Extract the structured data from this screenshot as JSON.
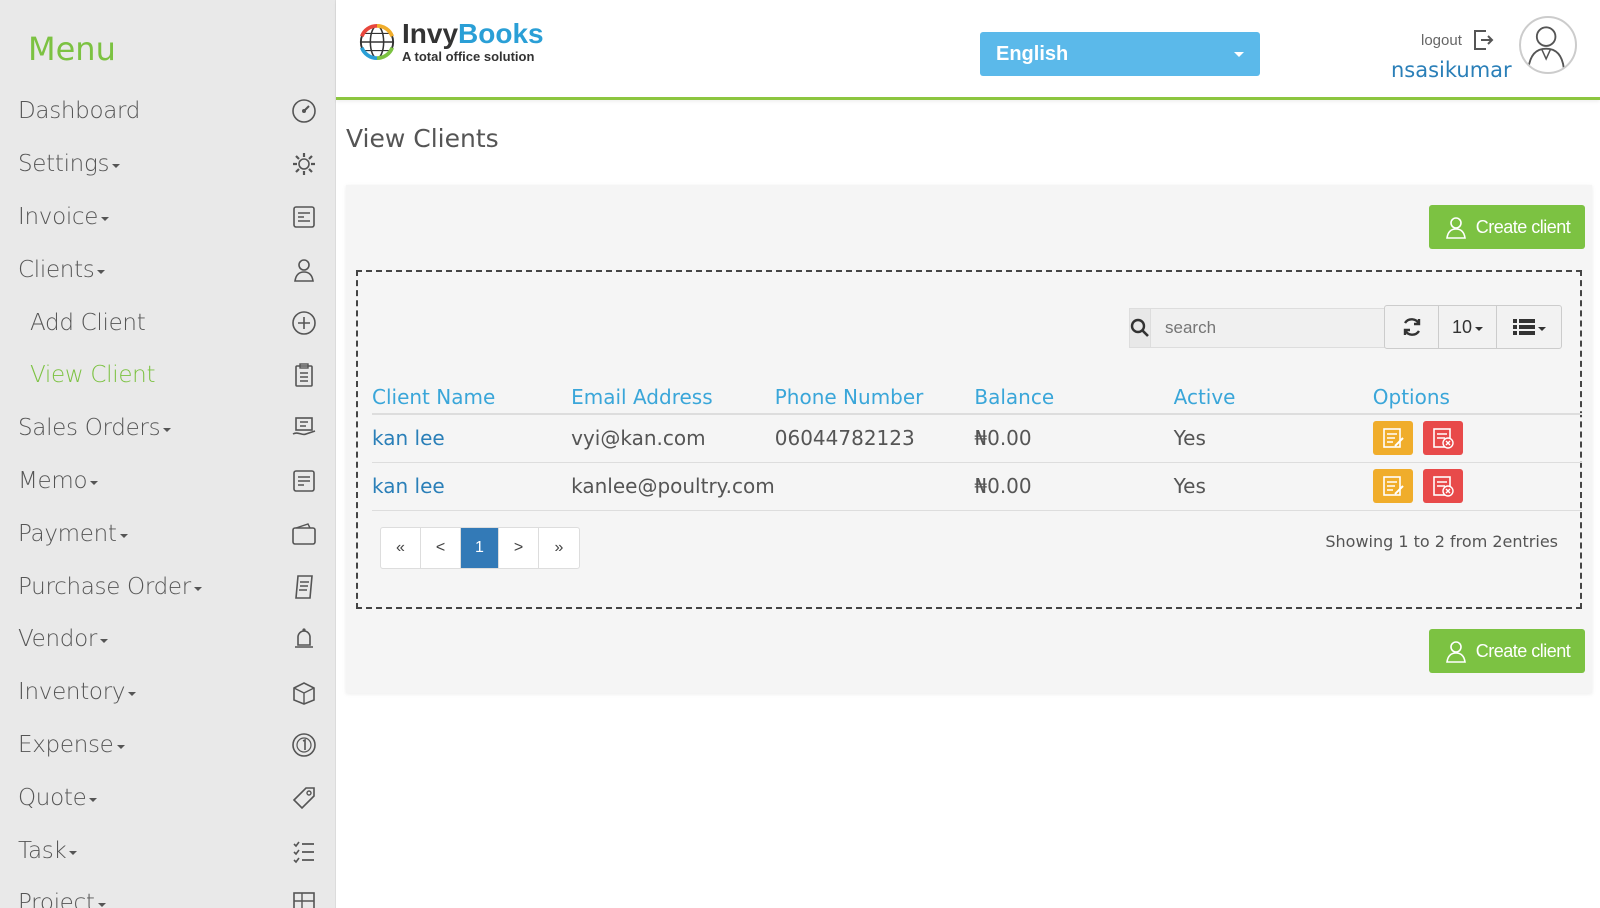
{
  "sidebar": {
    "menu_title": "Menu",
    "items": [
      {
        "label": "Dashboard",
        "caret": false,
        "icon": "dashboard-icon"
      },
      {
        "label": "Settings",
        "caret": true,
        "icon": "gear-icon"
      },
      {
        "label": "Invoice",
        "caret": true,
        "icon": "invoice-icon"
      },
      {
        "label": "Clients",
        "caret": true,
        "icon": "user-icon"
      },
      {
        "label": "Add Client",
        "caret": false,
        "icon": "plus-circle-icon",
        "sub": true
      },
      {
        "label": "View Client",
        "caret": false,
        "icon": "clipboard-icon",
        "sub": true,
        "active": true
      },
      {
        "label": "Sales Orders",
        "caret": true,
        "icon": "sales-icon"
      },
      {
        "label": "Memo",
        "caret": true,
        "icon": "memo-icon"
      },
      {
        "label": "Payment",
        "caret": true,
        "icon": "wallet-icon"
      },
      {
        "label": "Purchase Order",
        "caret": true,
        "icon": "receipt-icon"
      },
      {
        "label": "Vendor",
        "caret": true,
        "icon": "bell-icon"
      },
      {
        "label": "Inventory",
        "caret": true,
        "icon": "box-icon"
      },
      {
        "label": "Expense",
        "caret": true,
        "icon": "coin-icon"
      },
      {
        "label": "Quote",
        "caret": true,
        "icon": "tag-icon"
      },
      {
        "label": "Task",
        "caret": true,
        "icon": "checklist-icon"
      },
      {
        "label": "Project",
        "caret": true,
        "icon": "project-icon"
      }
    ]
  },
  "header": {
    "logo_name_a": "Invy",
    "logo_name_b": "Books",
    "logo_tagline": "A total office solution",
    "language": "English",
    "logout_label": "logout",
    "username": "nsasikumar"
  },
  "main": {
    "page_title": "View Clients",
    "create_button_label": "Create client",
    "search_placeholder": "search",
    "page_size": "10",
    "columns": [
      "Client Name",
      "Email Address",
      "Phone Number",
      "Balance",
      "Active",
      "Options"
    ],
    "rows": [
      {
        "name": "kan lee",
        "email": "vyi@kan.com",
        "phone": "06044782123",
        "balance": "₦0.00",
        "active": "Yes"
      },
      {
        "name": "kan lee",
        "email": "kanlee@poultry.com",
        "phone": "",
        "balance": "₦0.00",
        "active": "Yes"
      }
    ],
    "pagination": {
      "first": "«",
      "prev": "<",
      "current": "1",
      "next": ">",
      "last": "»"
    },
    "showing_text": "Showing 1 to 2 from 2entries"
  },
  "colors": {
    "accent_green": "#7cc242",
    "link_blue": "#2a7fb8",
    "header_blue": "#3aa6d9",
    "language_bg": "#5bb9ea",
    "edit_orange": "#f0ad2b",
    "delete_red": "#e84a4a"
  }
}
